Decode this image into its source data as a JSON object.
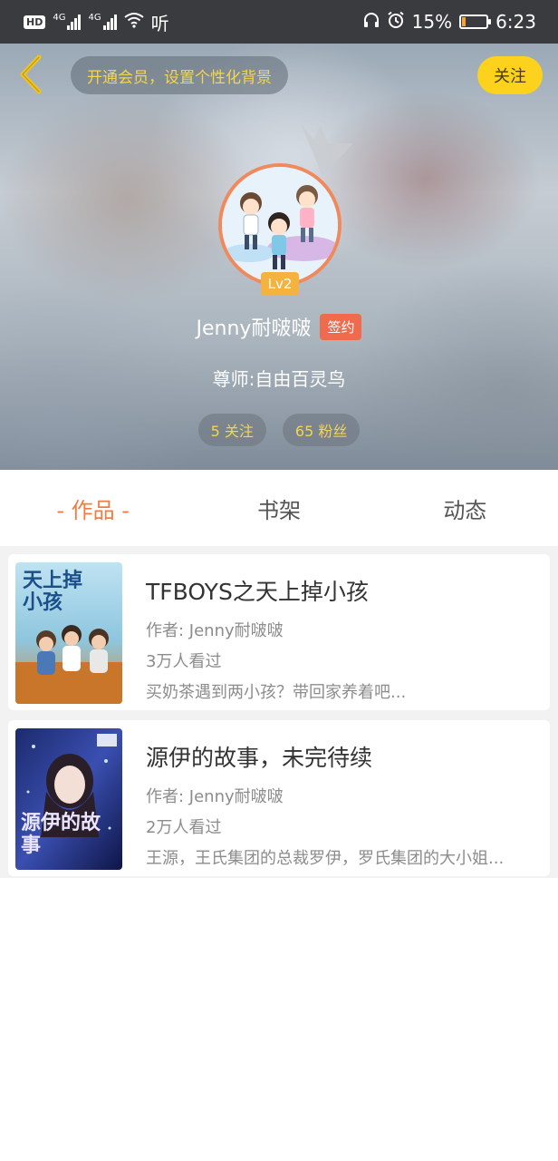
{
  "status_bar": {
    "hd_label": "HD",
    "network_1": "4G",
    "network_2": "4G",
    "extra_label": "听",
    "battery_percent": "15%",
    "time": "6:23",
    "battery_level": 0.15
  },
  "header": {
    "promo_text": "开通会员，设置个性化背景",
    "follow_label": "关注",
    "level_badge": "Lv2",
    "username": "Jenny耐啵啵",
    "sign_badge": "签约",
    "mentor_text": "尊师:自由百灵鸟",
    "stats": {
      "following": "5 关注",
      "followers": "65 粉丝"
    },
    "accent_color": "#fcd21d"
  },
  "tabs": [
    {
      "label": "- 作品 -",
      "active": true
    },
    {
      "label": "书架",
      "active": false
    },
    {
      "label": "动态",
      "active": false
    }
  ],
  "books": [
    {
      "title": "TFBOYS之天上掉小孩",
      "author": "作者: Jenny耐啵啵",
      "views": "3万人看过",
      "description": "买奶茶遇到两小孩？带回家养着吧...",
      "cover_text": "天上掉小孩"
    },
    {
      "title": "源伊的故事，未完待续",
      "author": "作者: Jenny耐啵啵",
      "views": "2万人看过",
      "description": "王源，王氏集团的总裁罗伊，罗氏集团的大小姐...",
      "cover_text": "源伊的故事"
    }
  ],
  "colors": {
    "active_tab": "#ef7d43",
    "sign_badge": "#ee6b4d",
    "level_badge": "#f4b23e"
  }
}
